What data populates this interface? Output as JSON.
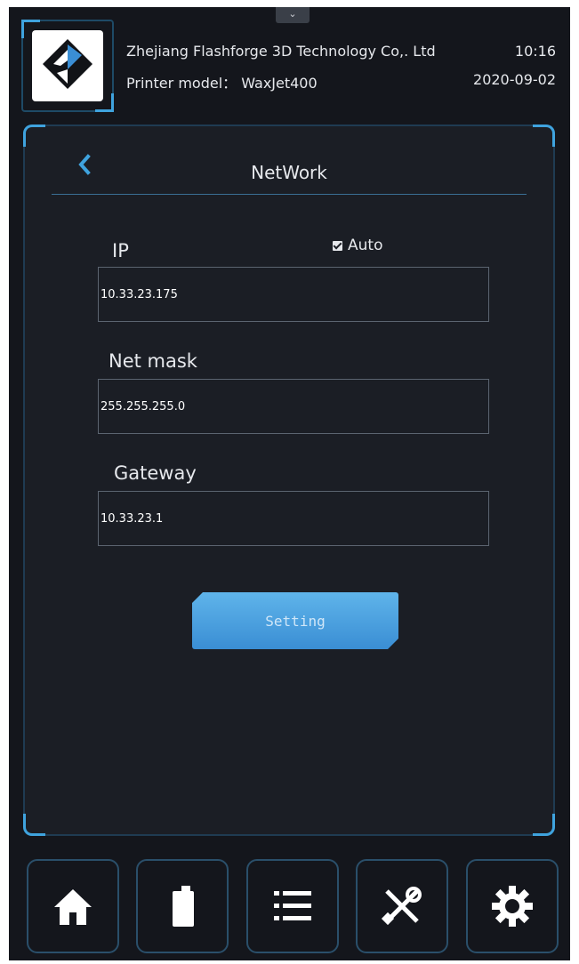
{
  "header": {
    "pull_tab_icon": "chevron-down-icon",
    "company": "Zhejiang Flashforge 3D Technology Co,. Ltd",
    "model": "Printer model： WaxJet400",
    "time": "10:16",
    "date": "2020-09-02",
    "logo": "flashforge-logo"
  },
  "network": {
    "title": "NetWork",
    "ip_label": "IP",
    "auto_label": "Auto",
    "auto_checked": true,
    "ip_value": "10.33.23.175",
    "netmask_label": "Net mask",
    "netmask_value": "255.255.255.0",
    "gateway_label": "Gateway",
    "gateway_value": "10.33.23.1",
    "setting_button": "Setting"
  },
  "nav": [
    {
      "icon": "home-icon"
    },
    {
      "icon": "material-bottle-icon"
    },
    {
      "icon": "list-icon"
    },
    {
      "icon": "tools-icon"
    },
    {
      "icon": "gear-icon"
    }
  ],
  "colors": {
    "background": "#14161c",
    "panel": "#1b1e25",
    "accent": "#3fa3de",
    "button": "#4aa0e0"
  }
}
